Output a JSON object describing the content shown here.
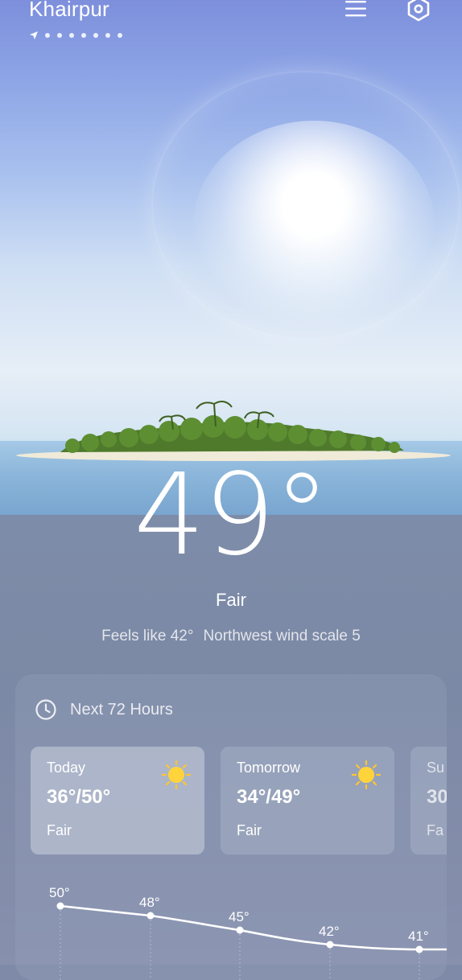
{
  "location": {
    "city": "Khairpur",
    "page_dots": 7
  },
  "current": {
    "temperature": "49°",
    "condition": "Fair",
    "feels_like": "Feels like 42°",
    "wind": "Northwest wind scale 5"
  },
  "forecast_card": {
    "title": "Next 72 Hours",
    "days": [
      {
        "name": "Today",
        "range": "36°/50°",
        "condition": "Fair",
        "icon": "sun-icon"
      },
      {
        "name": "Tomorrow",
        "range": "34°/49°",
        "condition": "Fair",
        "icon": "sun-icon"
      },
      {
        "name": "Su",
        "range": "30",
        "condition": "Fa",
        "icon": ""
      }
    ],
    "hourly_temps": [
      "50°",
      "48°",
      "45°",
      "42°",
      "41°"
    ]
  },
  "icons": {
    "menu": "menu-icon",
    "settings": "hexagon-settings-icon",
    "location": "location-arrow-icon",
    "clock": "clock-icon"
  },
  "colors": {
    "sun": "#ffd43a",
    "card_bg": "#9aa3bd"
  }
}
